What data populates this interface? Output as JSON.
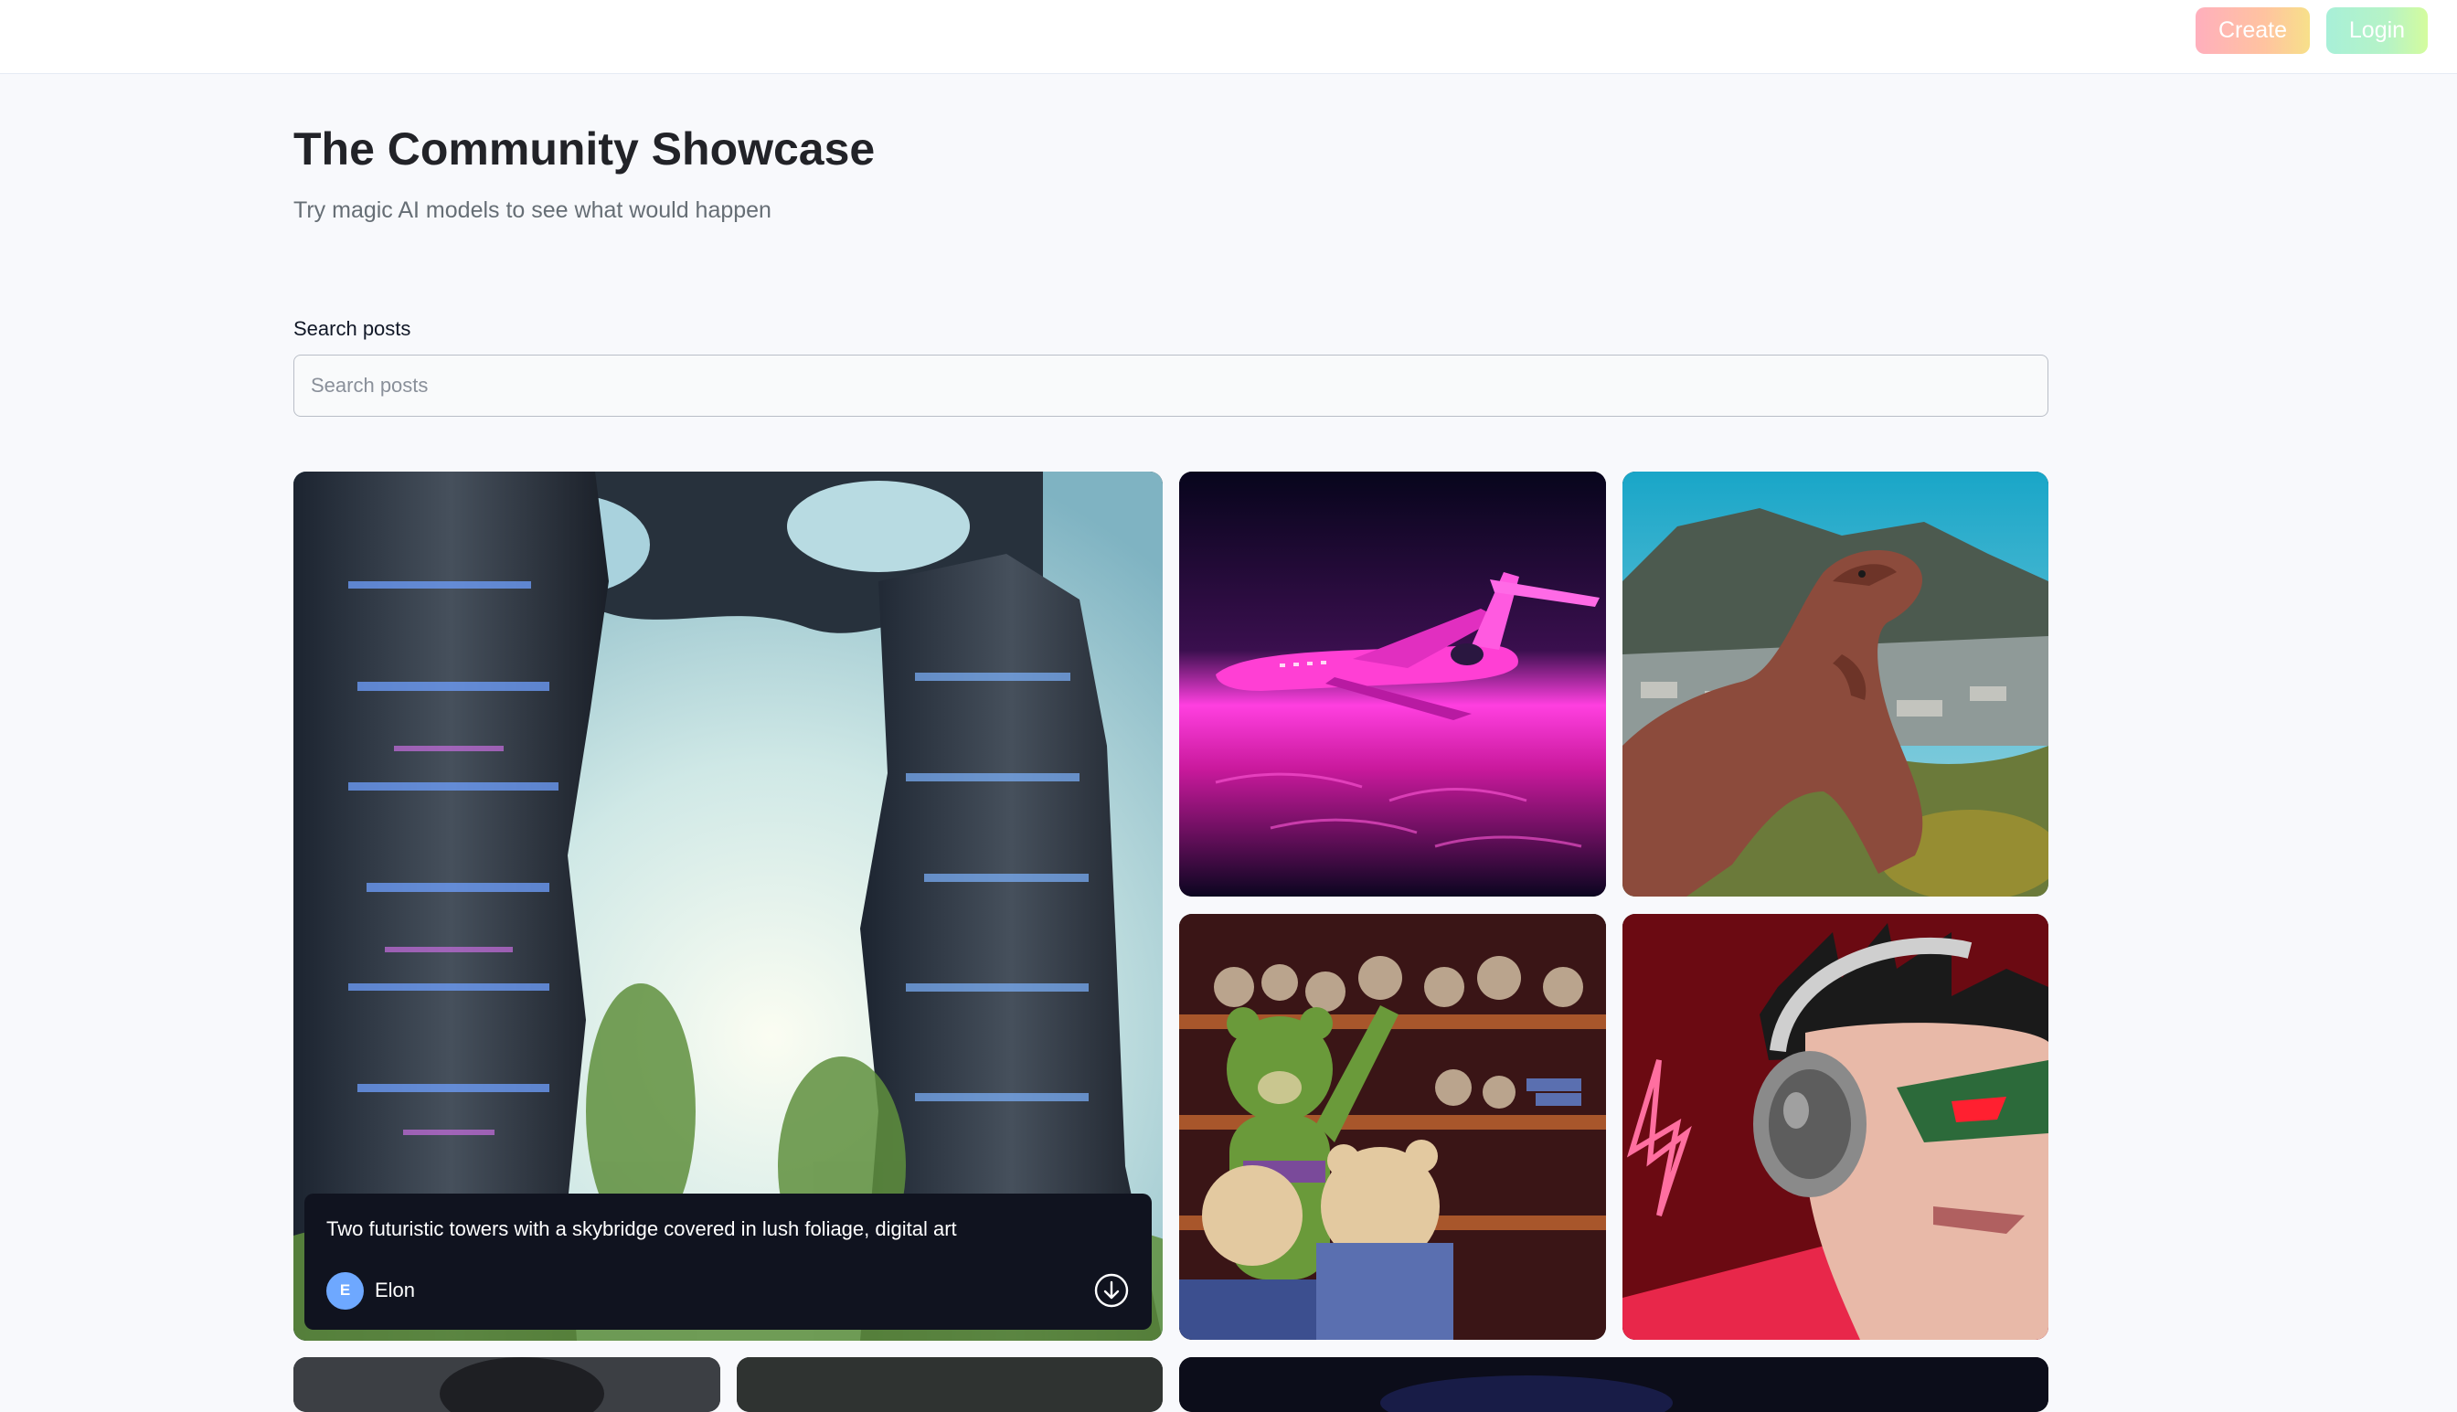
{
  "header": {
    "create_label": "Create",
    "login_label": "Login",
    "create_gradient": [
      "#ffafbd",
      "#ffc3a0",
      "#f7e08a"
    ],
    "login_gradient": [
      "#a8f0d8",
      "#b6f3c6",
      "#d4fc9e"
    ]
  },
  "hero": {
    "title": "The Community Showcase",
    "subtitle": "Try magic AI models to see what would happen"
  },
  "search": {
    "label": "Search posts",
    "placeholder": "Search posts",
    "value": ""
  },
  "gallery": {
    "posts": [
      {
        "image": "futuristic-towers-image",
        "prompt": "Two futuristic towers with a skybridge covered in lush foliage, digital art",
        "author": "Elon",
        "avatar_initial": "E",
        "avatar_color": "#6ea8ff",
        "action_icon": "download-icon"
      },
      {
        "image": "neon-jet-image"
      },
      {
        "image": "dinosaur-image"
      },
      {
        "image": "teddy-bears-shop-image"
      },
      {
        "image": "comic-hero-headphones-image"
      }
    ]
  }
}
